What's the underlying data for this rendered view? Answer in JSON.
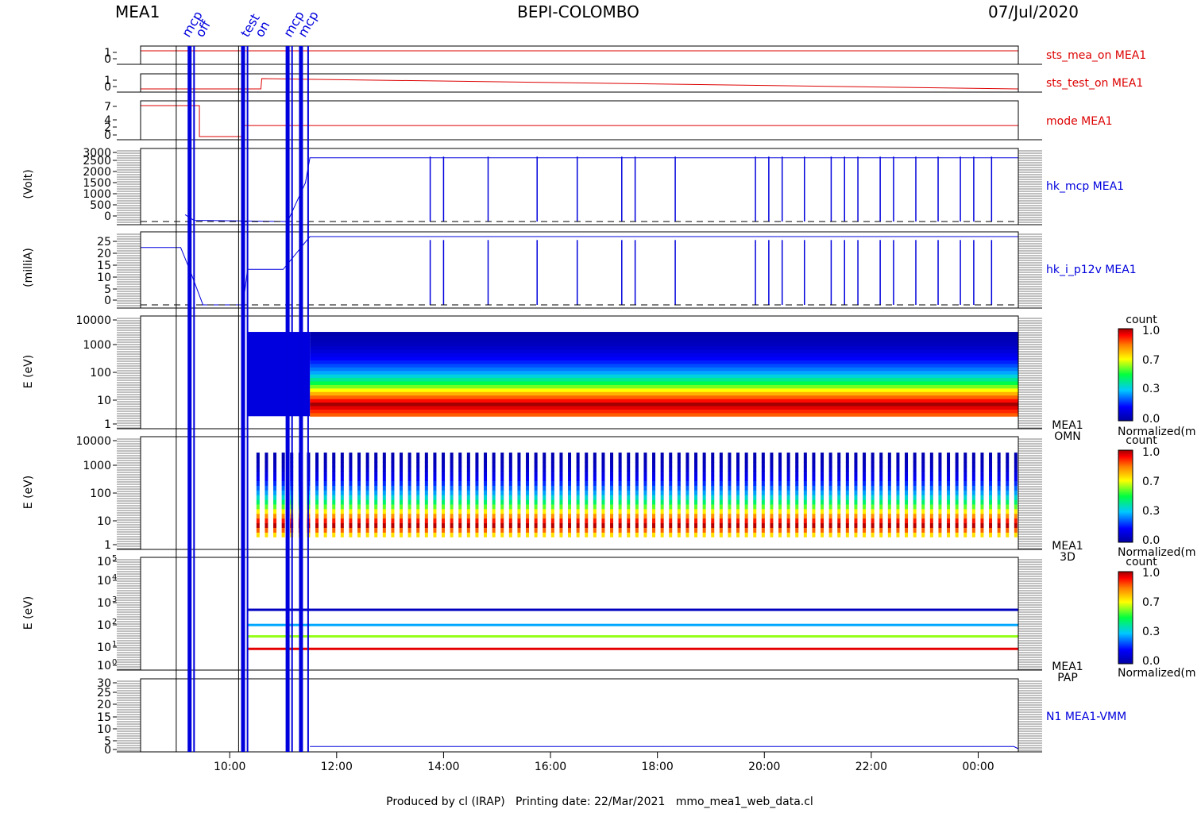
{
  "header": {
    "left": "MEA1",
    "center": "BEPI-COLOMBO",
    "right": "07/Jul/2020"
  },
  "footer": {
    "text": "Produced by cl (IRAP)   Printing date: 22/Mar/2021   mmo_mea1_web_data.cl"
  },
  "colors": {
    "red": "#dd0000",
    "blue": "#0000dd",
    "axis": "#000000"
  },
  "x_axis": {
    "ticks": [
      "10:00",
      "12:00",
      "14:00",
      "16:00",
      "18:00",
      "20:00",
      "22:00",
      "00:00"
    ]
  },
  "event_labels": [
    "mcp",
    "off",
    "test",
    "on",
    "mcp",
    "mcp"
  ],
  "panels": {
    "sts_mea_on": {
      "label": "sts_mea_on MEA1",
      "ticks": [
        "1",
        "0"
      ],
      "color": "#dd0000"
    },
    "sts_test_on": {
      "label": "sts_test_on MEA1",
      "ticks": [
        "1",
        "0"
      ],
      "color": "#dd0000"
    },
    "mode": {
      "label": "mode MEA1",
      "ticks": [
        "7",
        "4",
        "2",
        "0"
      ],
      "color": "#dd0000"
    },
    "hk_mcp": {
      "label": "hk_mcp MEA1",
      "ylabel": "(Volt)",
      "ticks": [
        "3000",
        "2500",
        "2000",
        "1500",
        "1000",
        "500",
        "0"
      ],
      "color": "#0000dd"
    },
    "hk_i_p12v": {
      "label": "hk_i_p12v MEA1",
      "ylabel": "(milliA)",
      "ticks": [
        "25",
        "20",
        "15",
        "10",
        "5",
        "0"
      ],
      "color": "#0000dd"
    },
    "omn": {
      "label_line1": "MEA1",
      "label_line2": "OMN",
      "ylabel": "E (eV)",
      "ticks": [
        "10000",
        "1000",
        "100",
        "10",
        "1"
      ]
    },
    "d3": {
      "label_line1": "MEA1",
      "label_line2": "3D",
      "ylabel": "E (eV)",
      "ticks": [
        "10000",
        "1000",
        "100",
        "10",
        "1"
      ]
    },
    "pap": {
      "label_line1": "MEA1",
      "label_line2": "PAP",
      "ylabel": "E (eV)",
      "ticks": [
        "10",
        "10",
        "10",
        "10",
        "10",
        "10"
      ],
      "exponents": [
        "5",
        "4",
        "3",
        "2",
        "1",
        "0"
      ]
    },
    "vmm": {
      "label": "N1 MEA1-VMM",
      "ticks": [
        "30",
        "25",
        "20",
        "15",
        "10",
        "5",
        "0"
      ],
      "color": "#0000dd"
    }
  },
  "colorbar": {
    "title": "count",
    "ticks": [
      "1.0",
      "0.7",
      "0.3",
      "0.0"
    ],
    "caption": "Normalized(m"
  },
  "chart_data": [
    {
      "type": "line",
      "name": "sts_mea_on MEA1",
      "x": [
        "08:20",
        "00:45"
      ],
      "y": [
        1,
        1
      ],
      "ylim": [
        0,
        1
      ]
    },
    {
      "type": "line",
      "name": "sts_test_on MEA1",
      "x": [
        "08:20",
        "10:35",
        "10:36",
        "00:45"
      ],
      "y": [
        0,
        0,
        1,
        0
      ],
      "ylim": [
        0,
        1
      ]
    },
    {
      "type": "line",
      "name": "mode MEA1",
      "x": [
        "08:20",
        "09:25",
        "09:26",
        "10:15",
        "10:16",
        "00:45"
      ],
      "y": [
        7,
        7,
        0,
        0,
        2.5,
        2.5
      ],
      "ylim": [
        0,
        7
      ]
    },
    {
      "type": "line",
      "name": "hk_mcp MEA1",
      "ylabel": "(Volt)",
      "ylim": [
        0,
        3000
      ],
      "x": [
        "09:10",
        "09:20",
        "11:05",
        "11:25",
        "11:30",
        "00:45"
      ],
      "y": [
        300,
        50,
        0,
        1700,
        2800,
        2800
      ],
      "drops_to_zero_at": [
        "13:45",
        "14:00",
        "14:50",
        "15:45",
        "16:30",
        "17:20",
        "17:35",
        "18:20",
        "19:50",
        "20:05",
        "20:20",
        "20:45",
        "21:15",
        "21:30",
        "21:45",
        "22:10",
        "22:25",
        "22:50",
        "23:15",
        "23:40",
        "23:55",
        "00:15"
      ]
    },
    {
      "type": "line",
      "name": "hk_i_p12v MEA1",
      "ylabel": "(milliA)",
      "ylim": [
        0,
        25
      ],
      "x": [
        "08:20",
        "09:05",
        "09:15",
        "09:30",
        "10:15",
        "10:20",
        "11:00",
        "11:30",
        "00:45"
      ],
      "y": [
        21,
        21,
        13,
        0,
        0,
        13,
        13,
        25,
        25
      ],
      "drops_to_zero_at": [
        "13:45",
        "14:00",
        "14:50",
        "15:45",
        "16:30",
        "17:20",
        "17:35",
        "18:20",
        "19:50",
        "20:05",
        "20:20",
        "20:45",
        "21:15",
        "21:30",
        "21:45",
        "22:10",
        "22:25",
        "22:50",
        "23:15",
        "23:40",
        "23:55",
        "00:15"
      ]
    },
    {
      "type": "heatmap",
      "name": "MEA1 OMN",
      "ylabel": "E (eV)",
      "ylim": [
        1,
        10000
      ],
      "x_range": [
        "10:20",
        "00:45"
      ],
      "energy_profile": {
        "E": [
          3,
          7,
          15,
          40,
          100,
          300,
          1000,
          3000
        ],
        "count": [
          0.85,
          1.0,
          0.8,
          0.5,
          0.3,
          0.15,
          0.05,
          0.02
        ]
      }
    },
    {
      "type": "heatmap",
      "name": "MEA1 3D",
      "ylabel": "E (eV)",
      "ylim": [
        1,
        10000
      ],
      "x_range": [
        "10:30",
        "00:45"
      ],
      "energy_profile": {
        "E": [
          3,
          7,
          15,
          40,
          100,
          300,
          1000,
          3000
        ],
        "count": [
          0.7,
          1.0,
          0.8,
          0.5,
          0.3,
          0.15,
          0.05,
          0.02
        ]
      }
    },
    {
      "type": "heatmap",
      "name": "MEA1 PAP",
      "ylabel": "E (eV)",
      "ylim": [
        1,
        100000
      ],
      "x_range": [
        "10:20",
        "00:45"
      ],
      "bands": [
        {
          "E": 500,
          "count": 0.05
        },
        {
          "E": 100,
          "count": 0.3
        },
        {
          "E": 30,
          "count": 0.6
        },
        {
          "E": 8,
          "count": 0.95
        }
      ]
    },
    {
      "type": "line",
      "name": "N1 MEA1-VMM",
      "ylim": [
        0,
        30
      ],
      "x": [
        "11:30",
        "00:40",
        "00:45"
      ],
      "y": [
        1,
        1,
        0
      ]
    }
  ]
}
